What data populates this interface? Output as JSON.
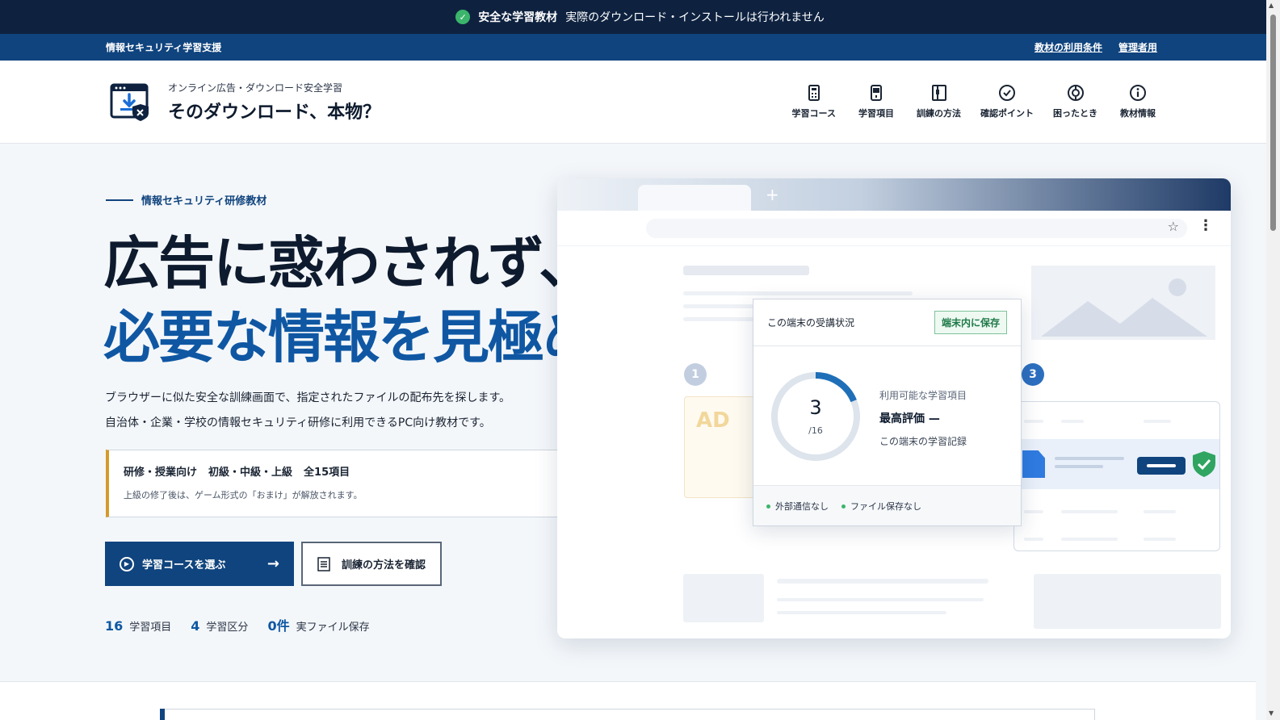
{
  "notice": {
    "title": "安全な学習教材",
    "message": "実際のダウンロード・インストールは行われません"
  },
  "subbar": {
    "site_label": "情報セキュリティ学習支援",
    "links": [
      "教材の利用条件",
      "管理者用"
    ]
  },
  "header": {
    "subtitle": "オンライン広告・ダウンロード安全学習",
    "title": "そのダウンロード、本物？",
    "nav": [
      {
        "label": "学習コース",
        "icon": "calculator-icon"
      },
      {
        "label": "学習項目",
        "icon": "device-icon"
      },
      {
        "label": "訓練の方法",
        "icon": "book-icon"
      },
      {
        "label": "確認ポイント",
        "icon": "check-circle-icon"
      },
      {
        "label": "困ったとき",
        "icon": "help-ring-icon"
      },
      {
        "label": "教材情報",
        "icon": "info-icon"
      }
    ]
  },
  "hero": {
    "eyebrow": "情報セキュリティ研修教材",
    "headline_1": "広告に惑わされず、",
    "headline_2": "必要な情報を見極める。",
    "lead_1": "ブラウザーに似た安全な訓練画面で、指定されたファイルの配布先を探します。",
    "lead_2": "自治体・企業・学校の情報セキュリティ研修に利用できるPC向け教材です。",
    "info_tags": [
      "研修・授業向け",
      "初級・中級・上級",
      "全15項目"
    ],
    "info_note": "上級の修了後は、ゲーム形式の「おまけ」が解放されます。",
    "primary_button": "学習コースを選ぶ",
    "secondary_button": "訓練の方法を確認",
    "stats": [
      {
        "num": "16",
        "label": "学習項目"
      },
      {
        "num": "4",
        "label": "学習区分"
      },
      {
        "num": "0件",
        "label": "実ファイル保存"
      }
    ]
  },
  "mock": {
    "step_1": "1",
    "step_3": "3",
    "ad_text": "AD"
  },
  "status_card": {
    "title": "この端末の受講状況",
    "badge": "端末内に保存",
    "progress_value": "3",
    "progress_total": "/16",
    "progress_fraction": 0.1875,
    "available_label": "利用可能な学習項目",
    "best_score": "最高評価 —",
    "record_label": "この端末の学習記録",
    "footer_items": [
      "外部通信なし",
      "ファイル保存なし"
    ]
  },
  "colors": {
    "navy": "#0e2240",
    "brand_blue": "#10447e",
    "accent_blue": "#0f57a3",
    "accent_orange": "#d59a2a",
    "ok_green": "#3bb56b"
  }
}
